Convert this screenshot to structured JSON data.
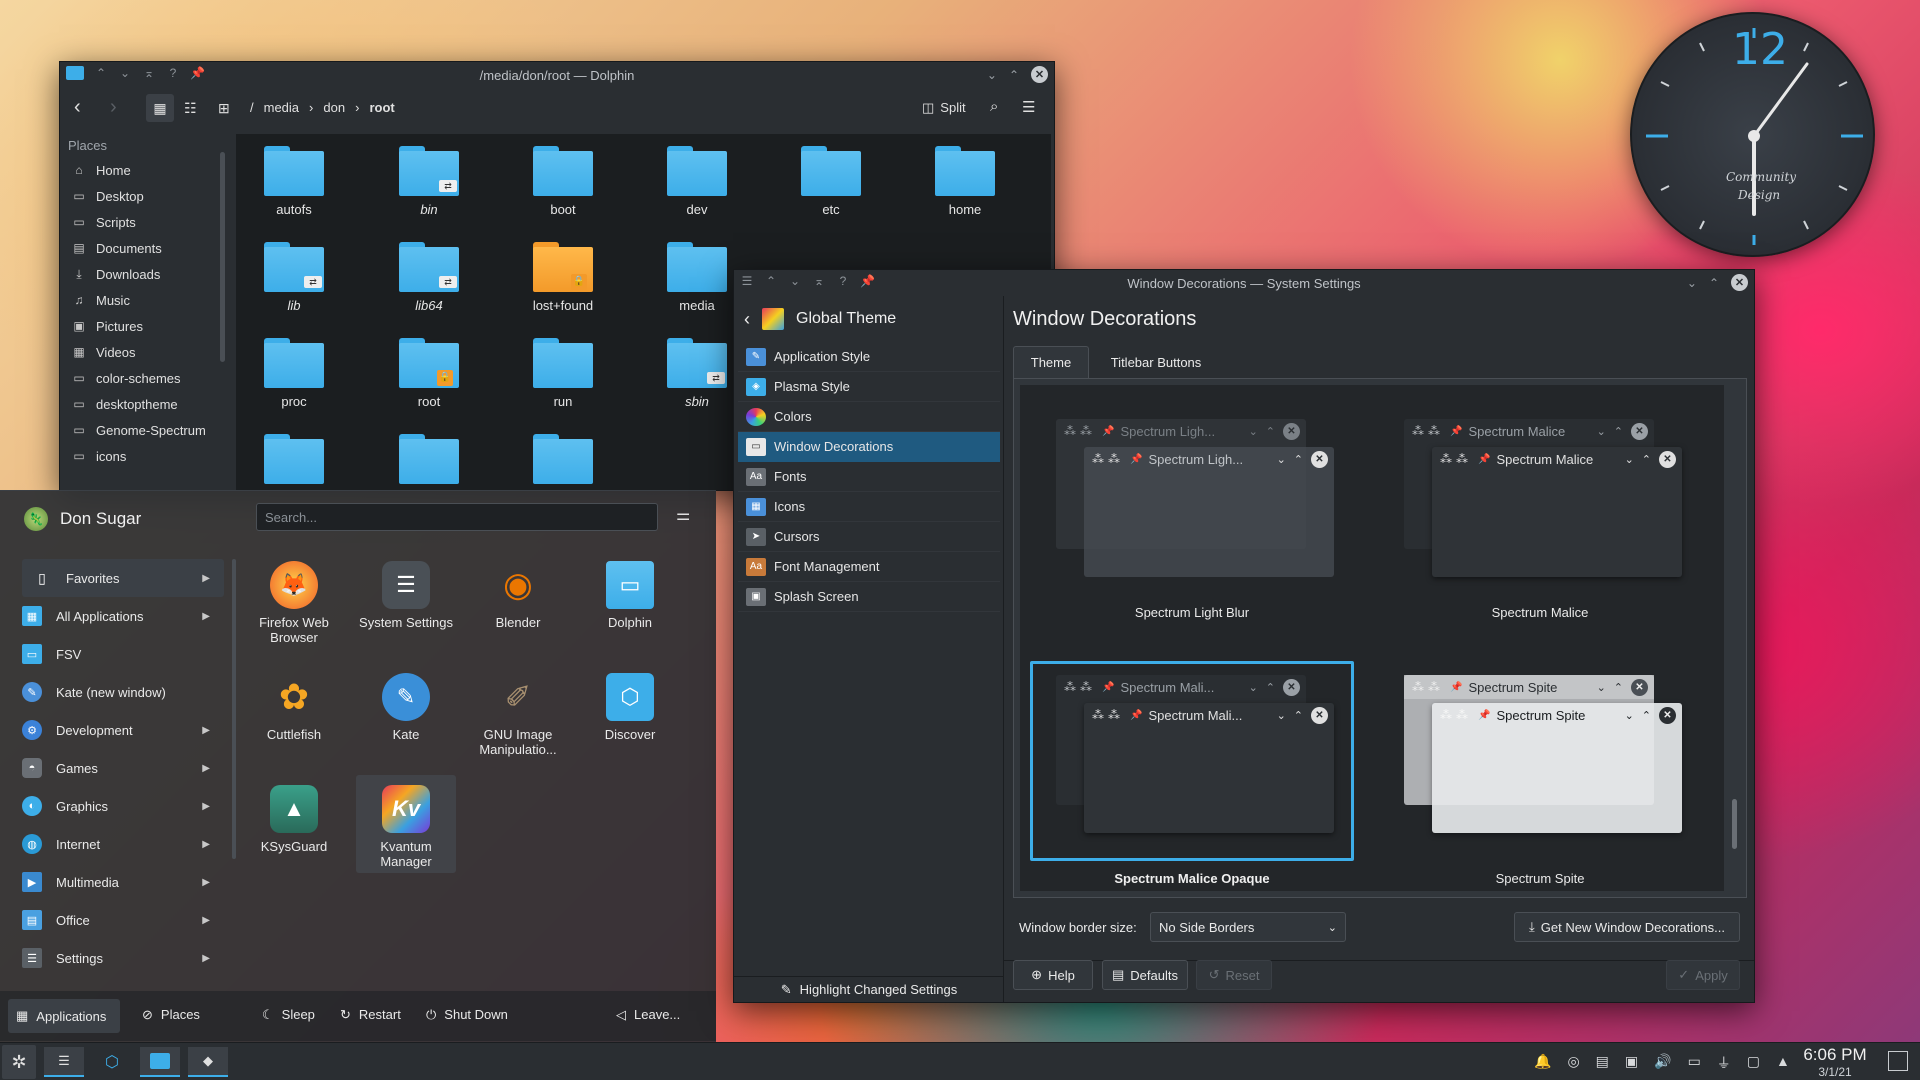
{
  "dolphin": {
    "title": "/media/don/root — Dolphin",
    "breadcrumb": [
      "/",
      "media",
      "don",
      "root"
    ],
    "split_label": "Split",
    "places_heading": "Places",
    "places": [
      "Home",
      "Desktop",
      "Scripts",
      "Documents",
      "Downloads",
      "Music",
      "Pictures",
      "Videos",
      "color-schemes",
      "desktoptheme",
      "Genome-Spectrum",
      "icons"
    ],
    "files": [
      {
        "name": "autofs",
        "italic": false,
        "badge": ""
      },
      {
        "name": "bin",
        "italic": true,
        "badge": "link"
      },
      {
        "name": "boot",
        "italic": false,
        "badge": ""
      },
      {
        "name": "dev",
        "italic": false,
        "badge": ""
      },
      {
        "name": "etc",
        "italic": false,
        "badge": ""
      },
      {
        "name": "home",
        "italic": false,
        "badge": ""
      },
      {
        "name": "lib",
        "italic": true,
        "badge": "link"
      },
      {
        "name": "lib64",
        "italic": true,
        "badge": "link"
      },
      {
        "name": "lost+found",
        "italic": false,
        "badge": "lock"
      },
      {
        "name": "media",
        "italic": false,
        "badge": ""
      },
      {
        "name": "proc",
        "italic": false,
        "badge": ""
      },
      {
        "name": "root",
        "italic": false,
        "badge": "lock"
      },
      {
        "name": "run",
        "italic": false,
        "badge": ""
      },
      {
        "name": "sbin",
        "italic": true,
        "badge": "link"
      }
    ]
  },
  "launcher": {
    "user": "Don Sugar",
    "search_placeholder": "Search...",
    "categories": [
      {
        "label": "Favorites",
        "arrow": true,
        "color": "#3a3f45"
      },
      {
        "label": "All Applications",
        "arrow": true,
        "color": "#3daee9"
      },
      {
        "label": "FSV",
        "arrow": false,
        "color": "#3daee9"
      },
      {
        "label": "Kate (new window)",
        "arrow": false,
        "color": "#4a90d9"
      },
      {
        "label": "Development",
        "arrow": true,
        "color": "#3b82d8"
      },
      {
        "label": "Games",
        "arrow": true,
        "color": "#6a6f75"
      },
      {
        "label": "Graphics",
        "arrow": true,
        "color": "#3daee9"
      },
      {
        "label": "Internet",
        "arrow": true,
        "color": "#2a9ad6"
      },
      {
        "label": "Multimedia",
        "arrow": true,
        "color": "#3a8ad0"
      },
      {
        "label": "Office",
        "arrow": true,
        "color": "#4aa0e0"
      },
      {
        "label": "Settings",
        "arrow": true,
        "color": "#5a6066"
      }
    ],
    "apps": [
      {
        "label": "Firefox Web Browser",
        "color": "#f05a28",
        "glyph": "🦊"
      },
      {
        "label": "System Settings",
        "color": "#4a5056",
        "glyph": "☰"
      },
      {
        "label": "Blender",
        "color": "#ea7600",
        "glyph": "◉"
      },
      {
        "label": "Dolphin",
        "color": "#3daee9",
        "glyph": "▭"
      },
      {
        "label": "Cuttlefish",
        "color": "#f5a623",
        "glyph": "✿"
      },
      {
        "label": "Kate",
        "color": "#3a8fd8",
        "glyph": "✎"
      },
      {
        "label": "GNU Image Manipulatio...",
        "color": "#6a5a4a",
        "glyph": "✐"
      },
      {
        "label": "Discover",
        "color": "#3daee9",
        "glyph": "⬡"
      },
      {
        "label": "KSysGuard",
        "color": "#2a8a7a",
        "glyph": "▲"
      },
      {
        "label": "Kvantum Manager",
        "color": "#d83a6a",
        "glyph": "Kv"
      }
    ],
    "bottom": {
      "applications": "Applications",
      "places": "Places",
      "sleep": "Sleep",
      "restart": "Restart",
      "shutdown": "Shut Down",
      "leave": "Leave..."
    }
  },
  "settings": {
    "title": "Window Decorations — System Settings",
    "back_label": "Global Theme",
    "page_title": "Window Decorations",
    "categories": [
      "Application Style",
      "Plasma Style",
      "Colors",
      "Window Decorations",
      "Fonts",
      "Icons",
      "Cursors",
      "Font Management",
      "Splash Screen"
    ],
    "cat_colors": [
      "#4a90d9",
      "#3daee9",
      "#e95420",
      "#3daee9",
      "#6a6f75",
      "#4a90d9",
      "#5a6066",
      "#c87a3a",
      "#6a6f75"
    ],
    "tabs": [
      "Theme",
      "Titlebar Buttons"
    ],
    "decorations": [
      {
        "name": "Spectrum Light Blur",
        "short": "Spectrum Ligh..."
      },
      {
        "name": "Spectrum Malice",
        "short": "Spectrum Malice"
      },
      {
        "name": "Spectrum Malice Opaque",
        "short": "Spectrum Mali..."
      },
      {
        "name": "Spectrum Spite",
        "short": "Spectrum Spite"
      }
    ],
    "border_label": "Window border size:",
    "border_value": "No Side Borders",
    "get_new": "Get New Window Decorations...",
    "highlight": "Highlight Changed Settings",
    "help": "Help",
    "defaults": "Defaults",
    "reset": "Reset",
    "apply": "Apply"
  },
  "clock": {
    "number": "12",
    "text1": "Community",
    "text2": "Design"
  },
  "taskbar": {
    "time": "6:06 PM",
    "date": "3/1/21"
  },
  "colors": {
    "accent": "#3daee9",
    "panel": "#2a2e32"
  }
}
